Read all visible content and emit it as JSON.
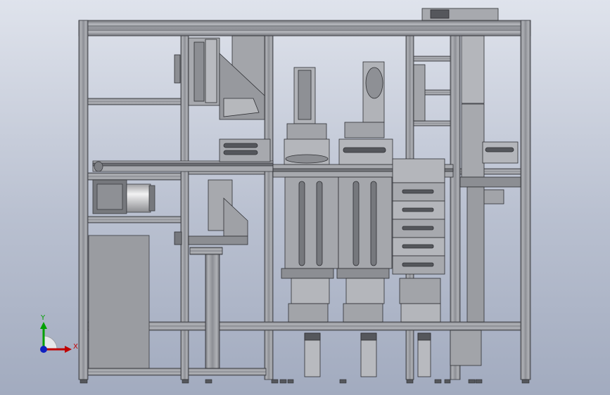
{
  "viewport": {
    "background_top": "#dfe3ec",
    "background_bottom": "#a2abbf"
  },
  "model": {
    "frame_color": "#8e9096",
    "frame_edge": "#3a3b40",
    "plate_color": "#a7a9ae",
    "panel_color": "#9a9ca1",
    "dark_part": "#55575c",
    "motor_color": "#d9dadc"
  },
  "triad": {
    "x_label": "X",
    "y_label": "Y",
    "x_color": "#c00000",
    "y_color": "#00a000",
    "z_color": "#1020c0",
    "x_icon": "axis-x-arrow",
    "y_icon": "axis-y-arrow",
    "z_icon": "axis-z-dot"
  }
}
